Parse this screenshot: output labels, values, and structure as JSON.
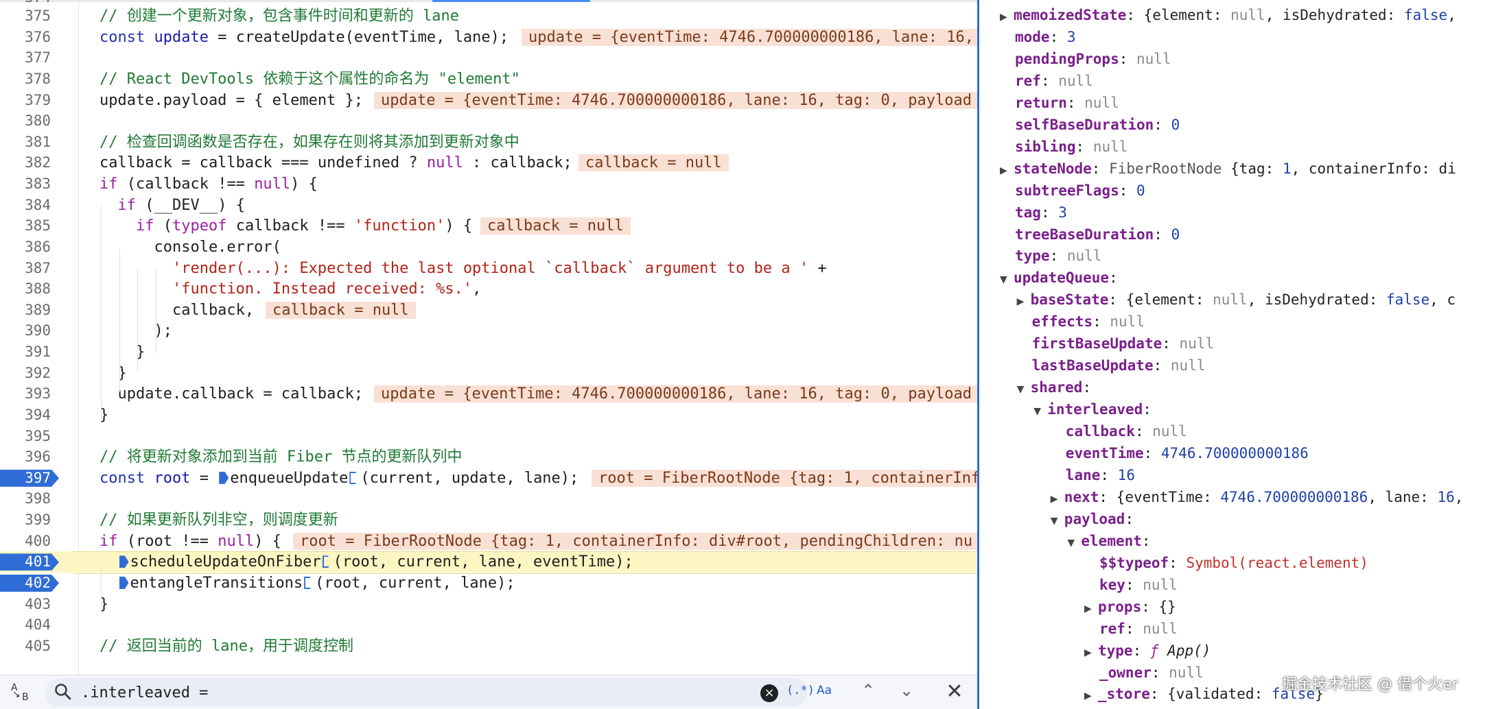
{
  "editor": {
    "first_line_fragment": "374",
    "lines": [
      {
        "n": "375",
        "tokens": [
          {
            "c": "cm",
            "t": "// 创建一个更新对象，包含事件时间和更新的 lane"
          }
        ]
      },
      {
        "n": "376",
        "tokens": [
          {
            "c": "kw2",
            "t": "const "
          },
          {
            "c": "id",
            "t": "update"
          },
          {
            "c": "pl",
            "t": " = createUpdate(eventTime, lane);"
          }
        ],
        "inline": "update = {eventTime: 4746.700000000186, lane: 16,"
      },
      {
        "n": "377",
        "tokens": []
      },
      {
        "n": "378",
        "tokens": [
          {
            "c": "cm",
            "t": "// React DevTools 依赖于这个属性的命名为 \"element\""
          }
        ]
      },
      {
        "n": "379",
        "tokens": [
          {
            "c": "pl",
            "t": "update.payload = { element };"
          }
        ],
        "inline": "update = {eventTime: 4746.700000000186, lane: 16, tag: 0, payload"
      },
      {
        "n": "380",
        "tokens": []
      },
      {
        "n": "381",
        "tokens": [
          {
            "c": "cm",
            "t": "// 检查回调函数是否存在，如果存在则将其添加到更新对象中"
          }
        ]
      },
      {
        "n": "382",
        "tokens": [
          {
            "c": "pl",
            "t": "callback = callback === undefined ? "
          },
          {
            "c": "kw",
            "t": "null"
          },
          {
            "c": "pl",
            "t": " : callback;"
          }
        ],
        "inline": "callback = null"
      },
      {
        "n": "383",
        "tokens": [
          {
            "c": "kw",
            "t": "if"
          },
          {
            "c": "pl",
            "t": " (callback !== "
          },
          {
            "c": "kw",
            "t": "null"
          },
          {
            "c": "pl",
            "t": ") {"
          }
        ]
      },
      {
        "n": "384",
        "tokens": [
          {
            "c": "pl",
            "t": "  "
          },
          {
            "c": "kw",
            "t": "if"
          },
          {
            "c": "pl",
            "t": " (__DEV__) {"
          }
        ]
      },
      {
        "n": "385",
        "tokens": [
          {
            "c": "pl",
            "t": "    "
          },
          {
            "c": "kw",
            "t": "if"
          },
          {
            "c": "pl",
            "t": " ("
          },
          {
            "c": "kw",
            "t": "typeof"
          },
          {
            "c": "pl",
            "t": " callback !== "
          },
          {
            "c": "str",
            "t": "'function'"
          },
          {
            "c": "pl",
            "t": ") {"
          }
        ],
        "inline": "callback = null"
      },
      {
        "n": "386",
        "tokens": [
          {
            "c": "pl",
            "t": "      console.error("
          }
        ]
      },
      {
        "n": "387",
        "tokens": [
          {
            "c": "pl",
            "t": "        "
          },
          {
            "c": "str",
            "t": "'render(...): Expected the last optional `callback` argument to be a '"
          },
          {
            "c": "pl",
            "t": " +"
          }
        ]
      },
      {
        "n": "388",
        "tokens": [
          {
            "c": "pl",
            "t": "        "
          },
          {
            "c": "str",
            "t": "'function. Instead received: %s.'"
          },
          {
            "c": "pl",
            "t": ","
          }
        ]
      },
      {
        "n": "389",
        "tokens": [
          {
            "c": "pl",
            "t": "        callback,"
          }
        ],
        "inline": "callback = null"
      },
      {
        "n": "390",
        "tokens": [
          {
            "c": "pl",
            "t": "      );"
          }
        ]
      },
      {
        "n": "391",
        "tokens": [
          {
            "c": "pl",
            "t": "    }"
          }
        ]
      },
      {
        "n": "392",
        "tokens": [
          {
            "c": "pl",
            "t": "  }"
          }
        ]
      },
      {
        "n": "393",
        "tokens": [
          {
            "c": "pl",
            "t": "  update.callback = callback;"
          }
        ],
        "inline": "update = {eventTime: 4746.700000000186, lane: 16, tag: 0, payload"
      },
      {
        "n": "394",
        "tokens": [
          {
            "c": "pl",
            "t": "}"
          }
        ]
      },
      {
        "n": "395",
        "tokens": []
      },
      {
        "n": "396",
        "tokens": [
          {
            "c": "cm",
            "t": "// 将更新对象添加到当前 Fiber 节点的更新队列中"
          }
        ]
      },
      {
        "n": "397",
        "bp": true,
        "tokens": [
          {
            "c": "kw2",
            "t": "const "
          },
          {
            "c": "id",
            "t": "root"
          },
          {
            "c": "pl",
            "t": " = "
          },
          {
            "c": "mk",
            "t": ""
          },
          {
            "c": "pl",
            "t": "enqueueUpdate"
          },
          {
            "c": "mkh",
            "t": ""
          },
          {
            "c": "pl",
            "t": "(current, update, lane);"
          }
        ],
        "inline": "root = FiberRootNode {tag: 1, containerInf"
      },
      {
        "n": "398",
        "tokens": []
      },
      {
        "n": "399",
        "tokens": [
          {
            "c": "cm",
            "t": "// 如果更新队列非空，则调度更新"
          }
        ]
      },
      {
        "n": "400",
        "tokens": [
          {
            "c": "kw",
            "t": "if"
          },
          {
            "c": "pl",
            "t": " (root !== "
          },
          {
            "c": "kw",
            "t": "null"
          },
          {
            "c": "pl",
            "t": ") {"
          }
        ],
        "inline": "root = FiberRootNode {tag: 1, containerInfo: div#root, pendingChildren: nu"
      },
      {
        "n": "401",
        "bp": true,
        "cur": true,
        "tokens": [
          {
            "c": "pl",
            "t": "  "
          },
          {
            "c": "mk",
            "t": ""
          },
          {
            "c": "pl",
            "t": "scheduleUpdateOnFiber"
          },
          {
            "c": "mkh",
            "t": ""
          },
          {
            "c": "pl",
            "t": "(root, current, lane, eventTime);"
          }
        ]
      },
      {
        "n": "402",
        "bp": true,
        "tokens": [
          {
            "c": "pl",
            "t": "  "
          },
          {
            "c": "mk",
            "t": ""
          },
          {
            "c": "pl",
            "t": "entangleTransitions"
          },
          {
            "c": "mkh",
            "t": ""
          },
          {
            "c": "pl",
            "t": "(root, current, lane);"
          }
        ]
      },
      {
        "n": "403",
        "tokens": [
          {
            "c": "pl",
            "t": "}"
          }
        ]
      },
      {
        "n": "404",
        "tokens": []
      },
      {
        "n": "405",
        "tokens": [
          {
            "c": "cm",
            "t": "// 返回当前的 lane，用于调度控制"
          }
        ]
      }
    ]
  },
  "search": {
    "case_icon_a": "A",
    "case_icon_b": "B",
    "query": ".interleaved =",
    "regex_label": "(.*)",
    "case_label": "Aa"
  },
  "scope": {
    "rows": [
      {
        "i": 0,
        "tri": "▶",
        "k": "memoizedState",
        "parts": [
          {
            "c": "v-obj",
            "t": "{element: "
          },
          {
            "c": "v-null",
            "t": "null"
          },
          {
            "c": "v-obj",
            "t": ", isDehydrated: "
          },
          {
            "c": "v-kw",
            "t": "false"
          },
          {
            "c": "v-obj",
            "t": ","
          }
        ]
      },
      {
        "i": 0,
        "k": "mode",
        "parts": [
          {
            "c": "v-num",
            "t": "3"
          }
        ]
      },
      {
        "i": 0,
        "k": "pendingProps",
        "parts": [
          {
            "c": "v-null",
            "t": "null"
          }
        ]
      },
      {
        "i": 0,
        "k": "ref",
        "parts": [
          {
            "c": "v-null",
            "t": "null"
          }
        ]
      },
      {
        "i": 0,
        "k": "return",
        "parts": [
          {
            "c": "v-null",
            "t": "null"
          }
        ]
      },
      {
        "i": 0,
        "k": "selfBaseDuration",
        "parts": [
          {
            "c": "v-num",
            "t": "0"
          }
        ]
      },
      {
        "i": 0,
        "k": "sibling",
        "parts": [
          {
            "c": "v-null",
            "t": "null"
          }
        ]
      },
      {
        "i": 0,
        "tri": "▶",
        "k": "stateNode",
        "parts": [
          {
            "c": "v-class",
            "t": "FiberRootNode "
          },
          {
            "c": "v-obj",
            "t": "{tag: "
          },
          {
            "c": "v-num",
            "t": "1"
          },
          {
            "c": "v-obj",
            "t": ", containerInfo: di"
          }
        ]
      },
      {
        "i": 0,
        "k": "subtreeFlags",
        "parts": [
          {
            "c": "v-num",
            "t": "0"
          }
        ]
      },
      {
        "i": 0,
        "k": "tag",
        "parts": [
          {
            "c": "v-num",
            "t": "3"
          }
        ]
      },
      {
        "i": 0,
        "k": "treeBaseDuration",
        "parts": [
          {
            "c": "v-num",
            "t": "0"
          }
        ]
      },
      {
        "i": 0,
        "k": "type",
        "parts": [
          {
            "c": "v-null",
            "t": "null"
          }
        ]
      },
      {
        "i": 0,
        "tri": "▼",
        "k": "updateQueue",
        "parts": []
      },
      {
        "i": 1,
        "tri": "▶",
        "k": "baseState",
        "parts": [
          {
            "c": "v-obj",
            "t": "{element: "
          },
          {
            "c": "v-null",
            "t": "null"
          },
          {
            "c": "v-obj",
            "t": ", isDehydrated: "
          },
          {
            "c": "v-kw",
            "t": "false"
          },
          {
            "c": "v-obj",
            "t": ", c"
          }
        ]
      },
      {
        "i": 1,
        "k": "effects",
        "parts": [
          {
            "c": "v-null",
            "t": "null"
          }
        ]
      },
      {
        "i": 1,
        "k": "firstBaseUpdate",
        "parts": [
          {
            "c": "v-null",
            "t": "null"
          }
        ]
      },
      {
        "i": 1,
        "k": "lastBaseUpdate",
        "parts": [
          {
            "c": "v-null",
            "t": "null"
          }
        ]
      },
      {
        "i": 1,
        "tri": "▼",
        "k": "shared",
        "parts": []
      },
      {
        "i": 2,
        "tri": "▼",
        "k": "interleaved",
        "parts": []
      },
      {
        "i": 3,
        "k": "callback",
        "parts": [
          {
            "c": "v-null",
            "t": "null"
          }
        ]
      },
      {
        "i": 3,
        "k": "eventTime",
        "parts": [
          {
            "c": "v-num",
            "t": "4746.700000000186"
          }
        ]
      },
      {
        "i": 3,
        "k": "lane",
        "parts": [
          {
            "c": "v-num",
            "t": "16"
          }
        ]
      },
      {
        "i": 3,
        "tri": "▶",
        "k": "next",
        "parts": [
          {
            "c": "v-obj",
            "t": "{eventTime: "
          },
          {
            "c": "v-num",
            "t": "4746.700000000186"
          },
          {
            "c": "v-obj",
            "t": ", lane: "
          },
          {
            "c": "v-num",
            "t": "16"
          },
          {
            "c": "v-obj",
            "t": ","
          }
        ]
      },
      {
        "i": 3,
        "tri": "▼",
        "k": "payload",
        "parts": []
      },
      {
        "i": 4,
        "tri": "▼",
        "k": "element",
        "parts": []
      },
      {
        "i": 5,
        "k": "$$typeof",
        "parts": [
          {
            "c": "v-str",
            "t": "Symbol(react.element)"
          }
        ]
      },
      {
        "i": 5,
        "k": "key",
        "parts": [
          {
            "c": "v-null",
            "t": "null"
          }
        ]
      },
      {
        "i": 5,
        "tri": "▶",
        "k": "props",
        "parts": [
          {
            "c": "v-obj",
            "t": "{}"
          }
        ]
      },
      {
        "i": 5,
        "k": "ref",
        "parts": [
          {
            "c": "v-null",
            "t": "null"
          }
        ]
      },
      {
        "i": 5,
        "tri": "▶",
        "k": "type",
        "parts": [
          {
            "c": "v-f",
            "t": "ƒ "
          },
          {
            "c": "v-fn",
            "t": "App()"
          }
        ]
      },
      {
        "i": 5,
        "k": "_owner",
        "parts": [
          {
            "c": "v-null",
            "t": "null"
          }
        ]
      },
      {
        "i": 5,
        "tri": "▶",
        "k": "_store",
        "parts": [
          {
            "c": "v-obj",
            "t": "{validated: "
          },
          {
            "c": "v-kw",
            "t": "false"
          },
          {
            "c": "v-obj",
            "t": "}"
          }
        ]
      }
    ]
  },
  "watermark": "掘金技术社区 @ 借个火er"
}
